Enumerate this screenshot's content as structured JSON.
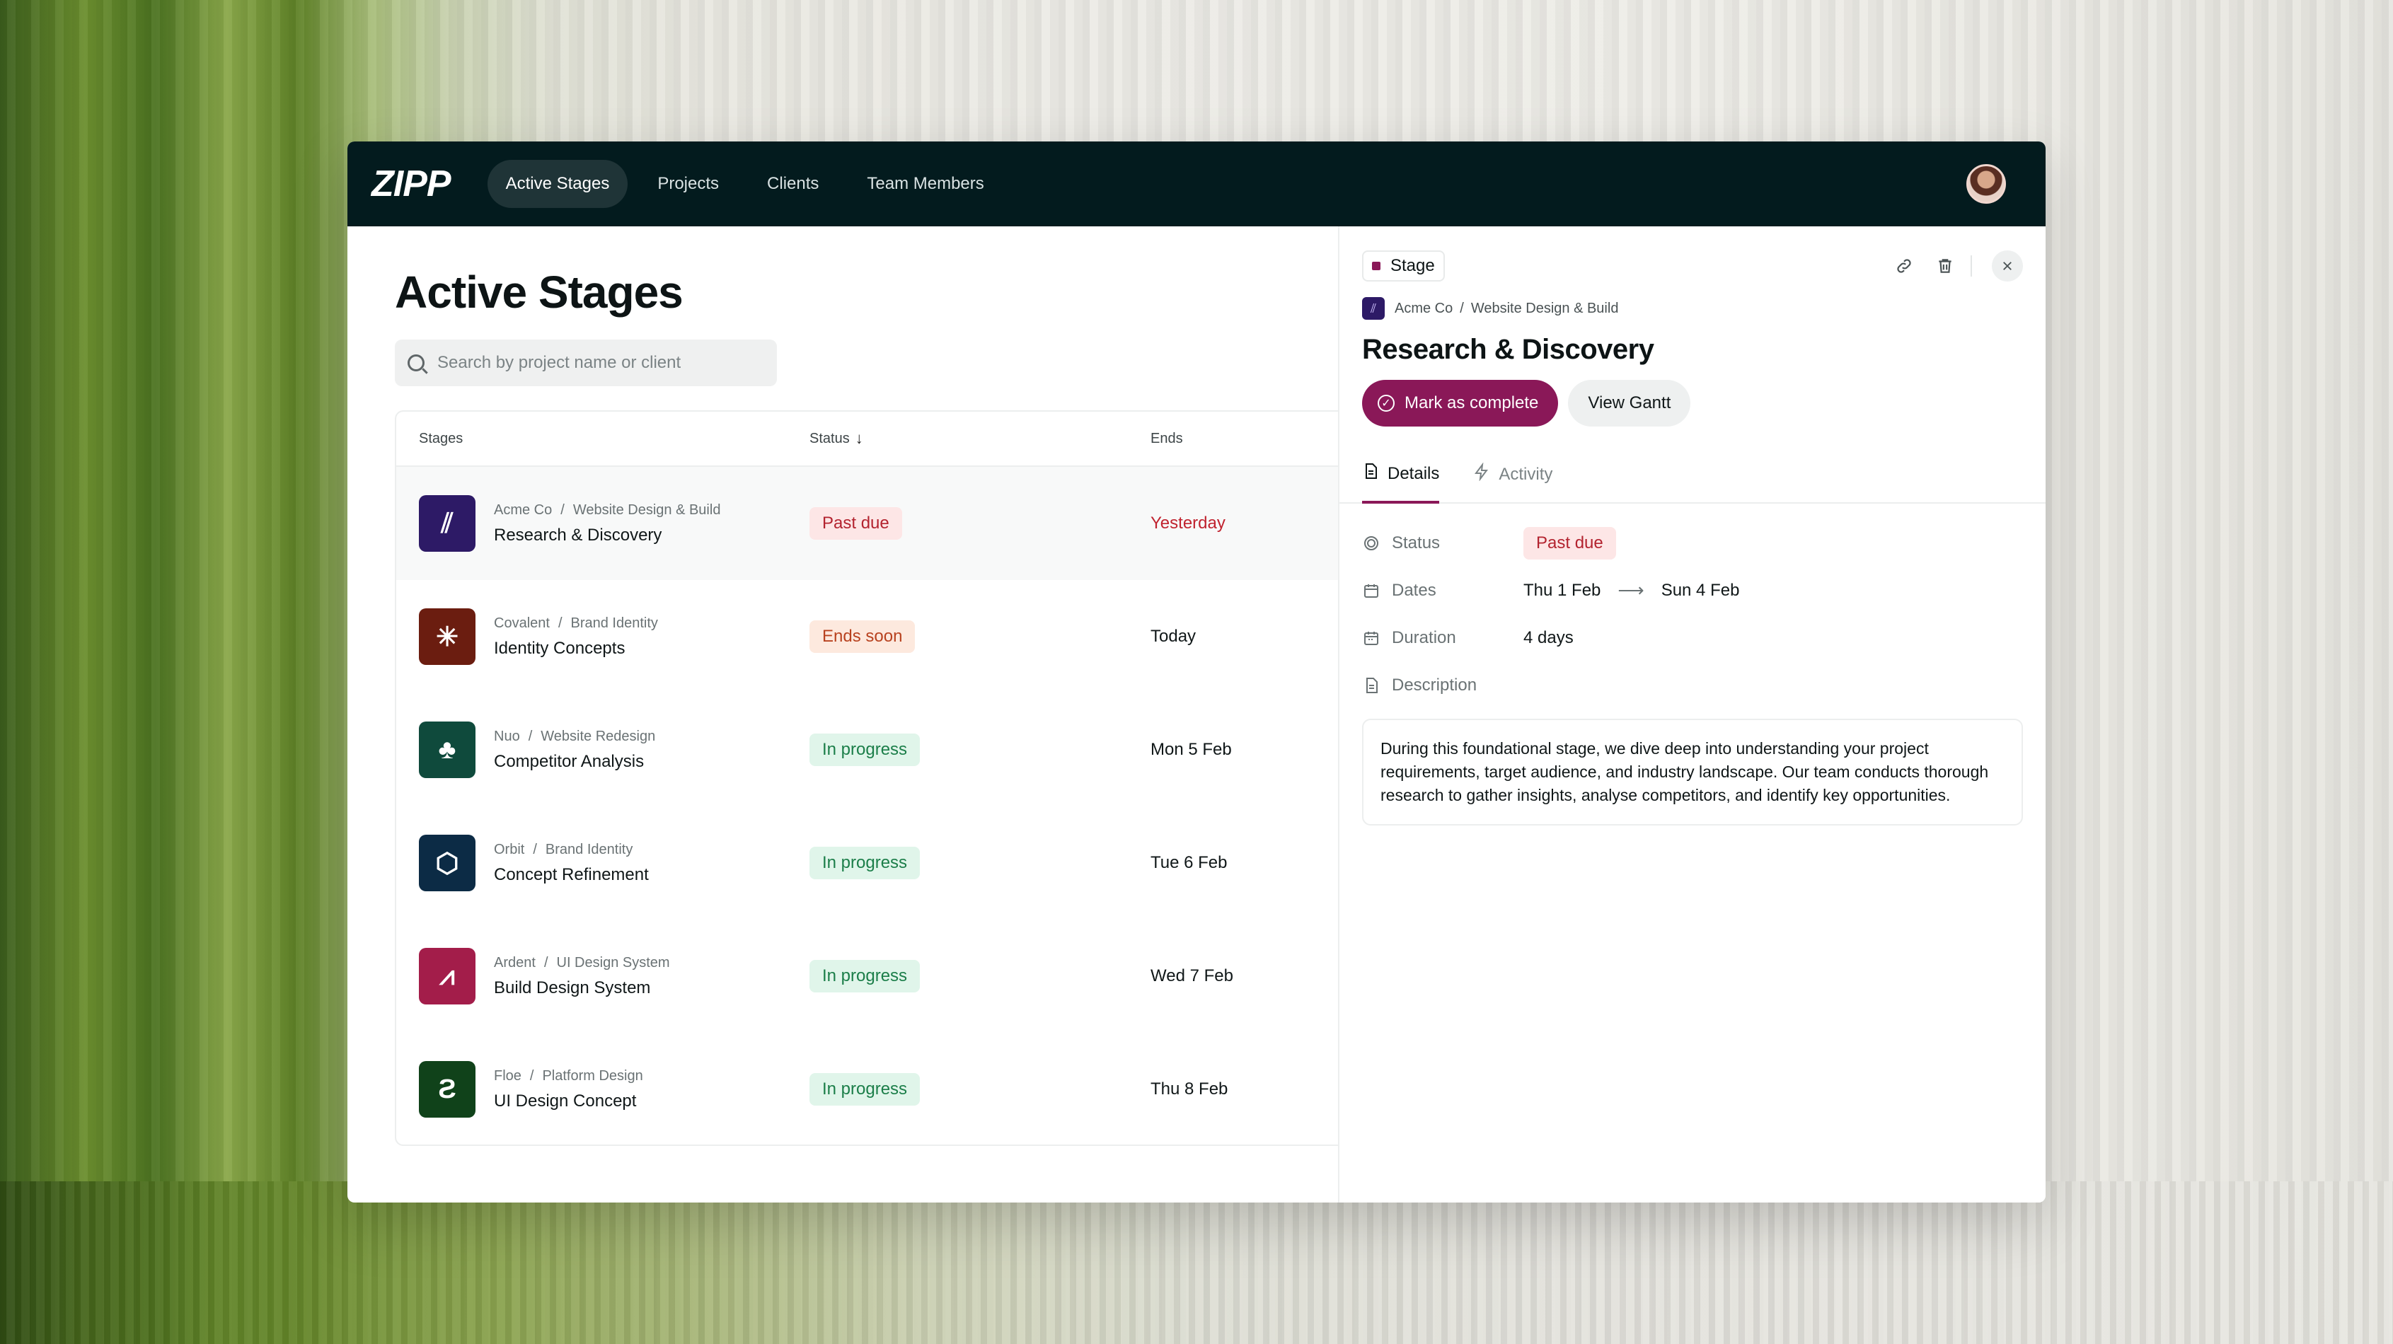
{
  "colors": {
    "topbar": "#031b1e",
    "accent": "#8a1858",
    "past_due": "#b3232f",
    "ends_soon": "#b8421f",
    "in_progress": "#1b7e49"
  },
  "app": {
    "logo": "ZIPP",
    "nav": [
      {
        "label": "Active Stages",
        "active": true
      },
      {
        "label": "Projects",
        "active": false
      },
      {
        "label": "Clients",
        "active": false
      },
      {
        "label": "Team Members",
        "active": false
      }
    ]
  },
  "main": {
    "title": "Active Stages",
    "search_placeholder": "Search by project name or client",
    "columns": {
      "stages": "Stages",
      "status": "Status",
      "ends": "Ends"
    },
    "rows": [
      {
        "client": "Acme Co",
        "project": "Website Design & Build",
        "stage": "Research & Discovery",
        "status": "Past due",
        "status_type": "red",
        "ends": "Yesterday",
        "ends_type": "red",
        "icon": "acme-logo-icon",
        "icon_color": "#2d1a66",
        "icon_glyph": "⫽"
      },
      {
        "client": "Covalent",
        "project": "Brand Identity",
        "stage": "Identity Concepts",
        "status": "Ends soon",
        "status_type": "orange",
        "ends": "Today",
        "ends_type": "normal",
        "icon": "covalent-logo-icon",
        "icon_color": "#6b1d10",
        "icon_glyph": "✳"
      },
      {
        "client": "Nuo",
        "project": "Website Redesign",
        "stage": "Competitor Analysis",
        "status": "In progress",
        "status_type": "green",
        "ends": "Mon 5 Feb",
        "ends_type": "normal",
        "icon": "nuo-logo-icon",
        "icon_color": "#0f4a3c",
        "icon_glyph": "♣"
      },
      {
        "client": "Orbit",
        "project": "Brand Identity",
        "stage": "Concept Refinement",
        "status": "In progress",
        "status_type": "green",
        "ends": "Tue 6 Feb",
        "ends_type": "normal",
        "icon": "orbit-logo-icon",
        "icon_color": "#0c2b45",
        "icon_glyph": "⬡"
      },
      {
        "client": "Ardent",
        "project": "UI Design System",
        "stage": "Build Design System",
        "status": "In progress",
        "status_type": "green",
        "ends": "Wed 7 Feb",
        "ends_type": "normal",
        "icon": "ardent-logo-icon",
        "icon_color": "#a31d4a",
        "icon_glyph": "⩘"
      },
      {
        "client": "Floe",
        "project": "Platform Design",
        "stage": "UI Design Concept",
        "status": "In progress",
        "status_type": "green",
        "ends": "Thu 8 Feb",
        "ends_type": "normal",
        "icon": "floe-logo-icon",
        "icon_color": "#10421a",
        "icon_glyph": "Ƨ"
      }
    ]
  },
  "panel": {
    "chip": "Stage",
    "client": "Acme Co",
    "project": "Website Design & Build",
    "title": "Research & Discovery",
    "mark_complete": "Mark as complete",
    "view_gantt": "View Gantt",
    "tabs": [
      "Details",
      "Activity"
    ],
    "labels": {
      "status": "Status",
      "dates": "Dates",
      "duration": "Duration",
      "description": "Description"
    },
    "status": "Past due",
    "date_start": "Thu 1 Feb",
    "date_end": "Sun 4 Feb",
    "duration": "4 days",
    "description": "During this foundational stage, we dive deep into understanding your project requirements, target audience, and industry landscape. Our team conducts thorough research to gather insights, analyse competitors, and identify key opportunities."
  }
}
